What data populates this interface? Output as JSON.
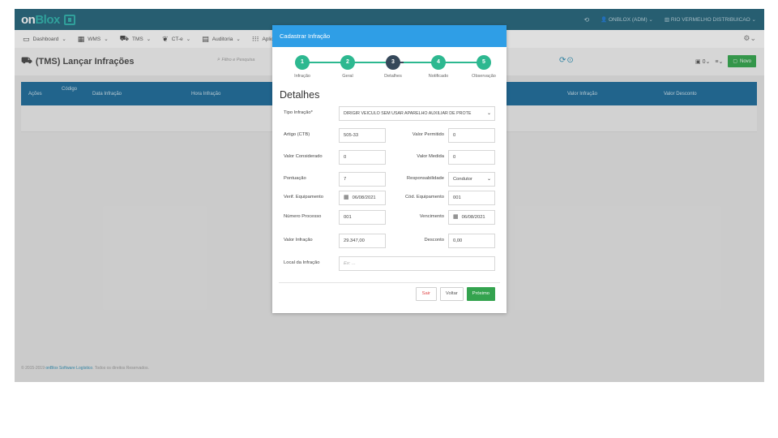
{
  "app": {
    "logo_text": "on",
    "logo_highlight": "Blox"
  },
  "topbar": {
    "user": "ONBLOX (ADM)",
    "company": "RIO VERMELHO DISTRIBUICAO"
  },
  "menubar": {
    "items": [
      {
        "label": "Dashboard",
        "icon": "monitor-icon"
      },
      {
        "label": "WMS",
        "icon": "grid-icon"
      },
      {
        "label": "TMS",
        "icon": "truck-icon"
      },
      {
        "label": "CT-e",
        "icon": "leaf-icon"
      },
      {
        "label": "Auditoria",
        "icon": "building-icon"
      },
      {
        "label": "Aplic",
        "icon": "apps-icon"
      }
    ]
  },
  "page": {
    "title": "(TMS) Lançar Infrações",
    "filter_placeholder": "Filtro e Pesquisa",
    "toolbar_count": "0",
    "novo_label": "Novo"
  },
  "table": {
    "headers": [
      "Ações",
      "Código",
      "Data Infração",
      "Hora Infração",
      "Valor Infração",
      "Valor Desconto"
    ]
  },
  "footer": {
    "prefix": "© 2015-2019",
    "brand": "onBlox Software Logístico",
    "suffix": ". Todos os direitos Reservados."
  },
  "modal": {
    "header": "Cadastrar Infração",
    "steps": [
      {
        "num": "1",
        "label": "Infração"
      },
      {
        "num": "2",
        "label": "Geral"
      },
      {
        "num": "3",
        "label": "Detalhes"
      },
      {
        "num": "4",
        "label": "Notificado"
      },
      {
        "num": "5",
        "label": "Observação"
      }
    ],
    "section_title": "Detalhes",
    "fields": {
      "tipo_infracao_label": "Tipo Infração*",
      "tipo_infracao_value": "DIRIGIR VEICULO SEM USAR APARELHO AUXILIAR DE PROTE",
      "artigo_label": "Artigo (CTB)",
      "artigo_value": "505-33",
      "valor_permitido_label": "Valor Permitido",
      "valor_permitido_value": "0",
      "valor_considerado_label": "Valor Considerado",
      "valor_considerado_value": "0",
      "valor_medida_label": "Valor Medida",
      "valor_medida_value": "0",
      "pontuacao_label": "Pontuação",
      "pontuacao_value": "7",
      "responsabilidade_label": "Responsabilidade",
      "responsabilidade_value": "Condutor",
      "verif_equip_label": "Verif. Equipamento",
      "verif_equip_value": "06/08/2021",
      "cod_equip_label": "Cód. Equipamento",
      "cod_equip_value": "001",
      "numero_processo_label": "Número Processo",
      "numero_processo_value": "001",
      "vencimento_label": "Vencimento",
      "vencimento_value": "06/08/2021",
      "valor_infracao_label": "Valor Infração",
      "valor_infracao_value": "29.347,00",
      "desconto_label": "Desconto",
      "desconto_value": "0,00",
      "local_label": "Local da Infração",
      "local_placeholder": "Ex: ..."
    },
    "buttons": {
      "sair": "Sair",
      "voltar": "Voltar",
      "proximo": "Próximo"
    }
  },
  "colors": {
    "topbar": "#1f6279",
    "modal_header": "#2f9ee6",
    "step_done": "#2db890",
    "step_active": "#35485a",
    "table_head": "#186a9a",
    "primary_green": "#34a34f"
  }
}
